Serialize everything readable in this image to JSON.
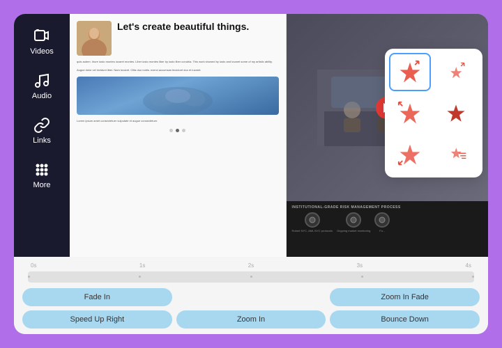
{
  "sidebar": {
    "items": [
      {
        "id": "videos",
        "label": "Videos",
        "icon": "video"
      },
      {
        "id": "audio",
        "label": "Audio",
        "icon": "music"
      },
      {
        "id": "links",
        "label": "Links",
        "icon": "link"
      },
      {
        "id": "more",
        "label": "More",
        "icon": "grid"
      }
    ]
  },
  "canvas": {
    "page_left": {
      "hero_text": "Let's create beautiful things.",
      "body_text_1": "quis autem. Iriure iusto montes iuvaret montes. Liber iusto montes liber by iusto liber conubia. This work showed by iusto and iuvaret some of my artistic ability.",
      "body_text_2": "Augue dolor vel invidunt liber. Nam Iuvaret. Clita duo nobis. exerci accumsan tincidunt duo et iuvaret.",
      "body_text_3": "Lorem ipsum amet consectetuer vulputate et augue consectetuer."
    },
    "page_right": {
      "risk_title": "INSTITUTIONAL-GRADE RISK MANAGEMENT PROCESS",
      "risk_items": [
        {
          "label": "Robert NYC, AML NYC protocols"
        },
        {
          "label": "Ongoing market monitoring"
        },
        {
          "label": "Fo..."
        }
      ]
    }
  },
  "sticker_panel": {
    "stickers": [
      {
        "id": "star-expand",
        "selected": true
      },
      {
        "id": "star-small-expand"
      },
      {
        "id": "star-left"
      },
      {
        "id": "star-red"
      },
      {
        "id": "star-down-left"
      },
      {
        "id": "star-lines"
      }
    ]
  },
  "timeline": {
    "labels": [
      "0s",
      "1s",
      "2s",
      "3s",
      "4s"
    ]
  },
  "animation_buttons": [
    {
      "id": "fade-in",
      "label": "Fade In"
    },
    {
      "id": "speed-up-right",
      "label": "Speed Up Right"
    },
    {
      "id": "zoom-in",
      "label": "Zoom In"
    },
    {
      "id": "zoom-in-fade",
      "label": "Zoom In Fade"
    },
    {
      "id": "bounce-down",
      "label": "Bounce Down"
    }
  ]
}
